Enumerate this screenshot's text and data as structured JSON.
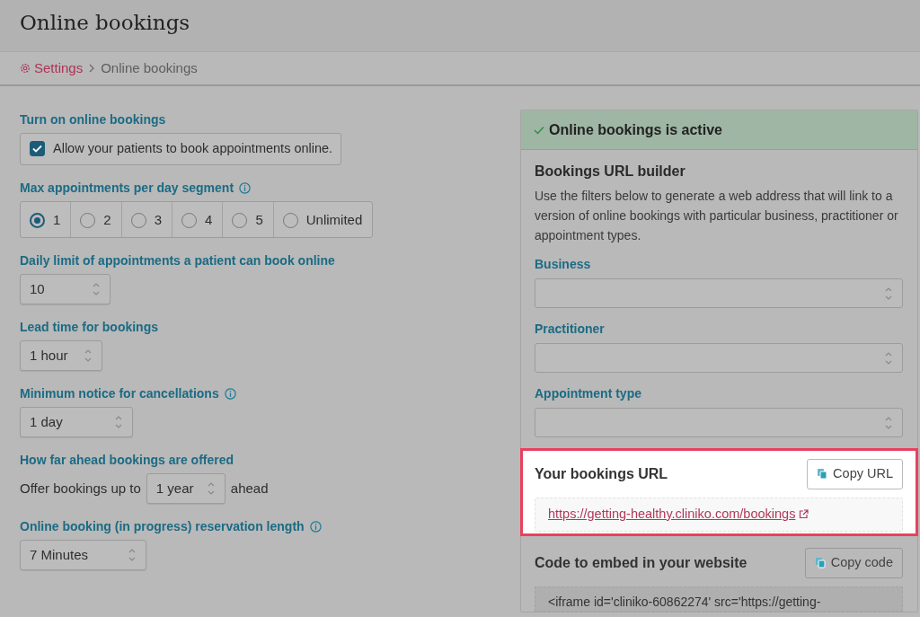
{
  "page": {
    "title": "Online bookings"
  },
  "breadcrumb": [
    {
      "label": "Settings",
      "kind": "link"
    },
    {
      "label": "Online bookings",
      "kind": "current"
    }
  ],
  "settings": [
    {
      "kind": "checkbox",
      "label": "Turn on online bookings",
      "info": false,
      "option": "Allow your patients to book appointments online.",
      "checked": true
    },
    {
      "kind": "radio",
      "label": "Max appointments per day segment",
      "info": true,
      "options": [
        {
          "label": "1",
          "selected": true
        },
        {
          "label": "2",
          "selected": false
        },
        {
          "label": "3",
          "selected": false
        },
        {
          "label": "4",
          "selected": false
        },
        {
          "label": "5",
          "selected": false
        },
        {
          "label": "Unlimited",
          "selected": false
        }
      ]
    },
    {
      "kind": "select",
      "label": "Daily limit of appointments a patient can book online",
      "info": false,
      "value": "10"
    },
    {
      "kind": "select",
      "label": "Lead time for bookings",
      "info": false,
      "value": "1 hour"
    },
    {
      "kind": "select",
      "label": "Minimum notice for cancellations",
      "info": true,
      "value": "1 day"
    },
    {
      "kind": "inline-select",
      "label": "How far ahead bookings are offered",
      "info": false,
      "prefix": "Offer bookings up to",
      "value": "1 year",
      "suffix": "ahead"
    },
    {
      "kind": "select",
      "label": "Online booking (in progress) reservation length",
      "info": true,
      "value": "7 Minutes"
    }
  ],
  "status": {
    "text": "Online bookings is active"
  },
  "builder": {
    "title": "Bookings URL builder",
    "description": "Use the filters below to generate a web address that will link to a version of online bookings with particular business, practitioner or appointment types.",
    "filters": [
      {
        "label": "Business"
      },
      {
        "label": "Practitioner"
      },
      {
        "label": "Appointment type"
      }
    ]
  },
  "url_section": {
    "title": "Your bookings URL",
    "button": "Copy URL",
    "url": "https://getting-healthy.cliniko.com/bookings",
    "highlighted": true
  },
  "embed_section": {
    "title": "Code to embed in your website",
    "button": "Copy code",
    "code": "<iframe id='cliniko-60862274' src='https://getting-"
  }
}
